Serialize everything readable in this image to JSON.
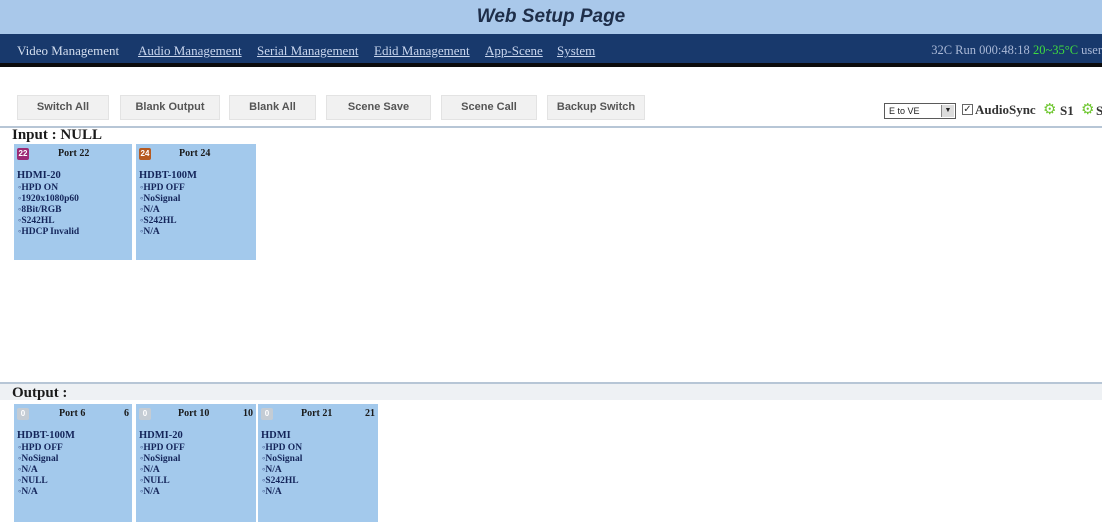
{
  "header": {
    "title": "Web Setup Page"
  },
  "nav": {
    "items": [
      "Video Management",
      "Audio Management",
      "Serial Management",
      "Edid Management",
      "App-Scene",
      "System"
    ],
    "status": {
      "prefix": "32C Run 000:48:18",
      "range": "20~35°C",
      "user": "user"
    }
  },
  "colors": {
    "accent": "#18396c",
    "card": "#a3c9ec",
    "title_bar": "#a9c8ea",
    "temp": "#3fdc3f"
  },
  "toolbar": {
    "buttons": [
      "Switch All",
      "Blank Output",
      "Blank All",
      "Scene Save",
      "Scene Call",
      "Backup Switch"
    ],
    "mode_select": "E to VE",
    "audio_sync_label": "AudioSync",
    "audio_sync_checked": true,
    "scene_labels": [
      "S1",
      "S"
    ],
    "icons": [
      "gear-icon",
      "gear-icon"
    ]
  },
  "input": {
    "title": "Input : NULL",
    "cards": [
      {
        "badge": "22",
        "badge_color": "#9c2a74",
        "port": "Port 22",
        "type": "HDMI-20",
        "lines": [
          "HPD ON",
          "1920x1080p60",
          "8Bit/RGB",
          "S242HL",
          "HDCP Invalid"
        ]
      },
      {
        "badge": "24",
        "badge_color": "#b65a20",
        "port": "Port 24",
        "type": "HDBT-100M",
        "lines": [
          "HPD OFF",
          "NoSignal",
          "N/A",
          "S242HL",
          "N/A"
        ]
      }
    ]
  },
  "output": {
    "title": "Output :",
    "cards": [
      {
        "badge": "0",
        "badge_color": "#c4ccd4",
        "port": "Port 6",
        "num": "6",
        "type": "HDBT-100M",
        "lines": [
          "HPD OFF",
          "NoSignal",
          "N/A",
          "NULL",
          "N/A"
        ]
      },
      {
        "badge": "0",
        "badge_color": "#c4ccd4",
        "port": "Port 10",
        "num": "10",
        "type": "HDMI-20",
        "lines": [
          "HPD OFF",
          "NoSignal",
          "N/A",
          "NULL",
          "N/A"
        ]
      },
      {
        "badge": "0",
        "badge_color": "#c4ccd4",
        "port": "Port 21",
        "num": "21",
        "type": "HDMI",
        "lines": [
          "HPD ON",
          "NoSignal",
          "N/A",
          "S242HL",
          "N/A"
        ]
      }
    ]
  }
}
